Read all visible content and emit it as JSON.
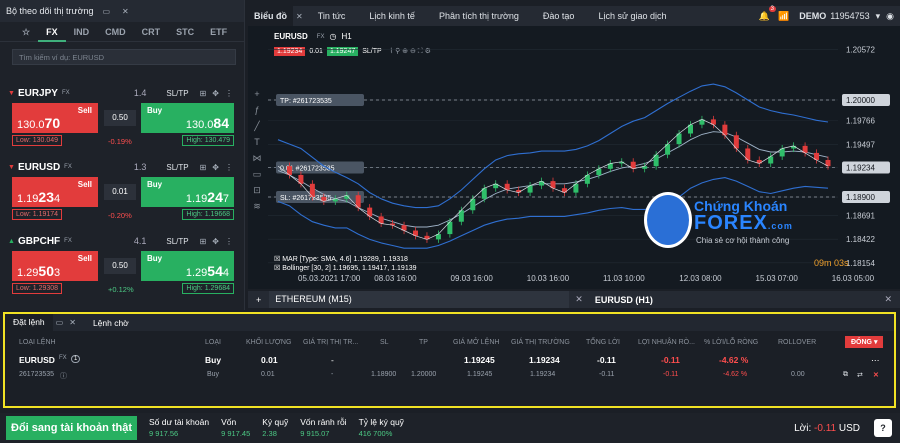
{
  "watchlist": {
    "title": "Bộ theo dõi thị trường",
    "tabs": [
      "FX",
      "IND",
      "CMD",
      "CRT",
      "STC",
      "ETF"
    ],
    "active_tab": "FX",
    "search_placeholder": "Tìm kiếm ví dụ: EURUSD",
    "instruments": [
      {
        "name": "EURJPY",
        "type": "FX",
        "spread": "1.4",
        "sell_label": "Sell",
        "buy_label": "Buy",
        "sell_price_main": "130.0",
        "sell_price_big": "70",
        "buy_price_main": "130.0",
        "buy_price_big": "84",
        "qty": "0.50",
        "low": "Low: 130.049",
        "high": "High: 130.479",
        "change": "-0.19%",
        "change_color": "#ff4e4e"
      },
      {
        "name": "EURUSD",
        "type": "FX",
        "spread": "1.3",
        "sell_label": "Sell",
        "buy_label": "Buy",
        "sell_price_main": "1.19",
        "sell_price_big": "23",
        "sell_price_tail": "4",
        "buy_price_main": "1.19",
        "buy_price_big": "24",
        "buy_price_tail": "7",
        "qty": "0.01",
        "low": "Low: 1.19174",
        "high": "High: 1.19668",
        "change": "-0.20%",
        "change_color": "#ff4e4e"
      },
      {
        "name": "GBPCHF",
        "type": "FX",
        "spread": "4.1",
        "sell_label": "Sell",
        "buy_label": "Buy",
        "sell_price_main": "1.29",
        "sell_price_big": "50",
        "sell_price_tail": "3",
        "buy_price_main": "1.29",
        "buy_price_big": "54",
        "buy_price_tail": "4",
        "qty": "0.50",
        "low": "Low: 1.29308",
        "high": "High: 1.29684",
        "change": "+0.12%",
        "change_color": "#4cc984"
      }
    ],
    "sltp_label": "SL/TP"
  },
  "chart_header": {
    "active": "Biểu đồ",
    "tabs": [
      "Tin tức",
      "Lịch kinh tế",
      "Phân tích thị trường",
      "Đào tạo",
      "Lịch sử giao dịch"
    ],
    "badge": "3",
    "account": "DEMO",
    "account_id": "11954753"
  },
  "chart_toolbar": {
    "symbol": "EURUSD",
    "type": "FX",
    "timeframe": "H1",
    "sell": "1.19234",
    "qty": "0.01",
    "buy": "1.19247",
    "sltp": "SL/TP"
  },
  "chart_data": {
    "type": "line",
    "y_ticks": [
      "1.20572",
      "1.20000",
      "1.19766",
      "1.19497",
      "1.19234",
      "1.18900",
      "1.18691",
      "1.18422",
      "1.18154"
    ],
    "x_ticks": [
      "05.03.2021 17:00",
      "08.03 16:00",
      "09.03 16:00",
      "10.03 16:00",
      "11.03 10:00",
      "12.03 08:00",
      "15.03 07:00",
      "16.03 05:00"
    ],
    "ylim": [
      1.1805,
      1.2068
    ],
    "price_line": [
      1.1925,
      1.1915,
      1.1905,
      1.189,
      1.1885,
      1.1888,
      1.1892,
      1.1878,
      1.1868,
      1.186,
      1.1858,
      1.1852,
      1.1846,
      1.1842,
      1.1848,
      1.1862,
      1.1875,
      1.1888,
      1.19,
      1.1905,
      1.1898,
      1.1895,
      1.1903,
      1.1908,
      1.19,
      1.1895,
      1.1905,
      1.1915,
      1.1922,
      1.1928,
      1.193,
      1.1922,
      1.1925,
      1.1938,
      1.195,
      1.1962,
      1.1972,
      1.1978,
      1.1972,
      1.196,
      1.1945,
      1.1932,
      1.1928,
      1.1936,
      1.1945,
      1.1948,
      1.194,
      1.1932,
      1.1925
    ],
    "ma_line": [
      1.192,
      1.1915,
      1.1908,
      1.19,
      1.1893,
      1.1888,
      1.1885,
      1.1878,
      1.1872,
      1.1866,
      1.1862,
      1.1858,
      1.1856,
      1.1856,
      1.1858,
      1.1864,
      1.1871,
      1.1879,
      1.1887,
      1.1894,
      1.1899,
      1.1901,
      1.1903,
      1.1905,
      1.1905,
      1.1905,
      1.1907,
      1.191,
      1.1914,
      1.1919,
      1.1923,
      1.1925,
      1.1928,
      1.1933,
      1.194,
      1.1947,
      1.1955,
      1.1961,
      1.1964,
      1.1963,
      1.1958,
      1.1951,
      1.1944,
      1.1941,
      1.1941,
      1.1942,
      1.1941,
      1.1938,
      1.1935
    ],
    "upper_band": [
      1.1955,
      1.195,
      1.1945,
      1.1935,
      1.1925,
      1.1918,
      1.1912,
      1.1905,
      1.1895,
      1.1888,
      1.1883,
      1.188,
      1.1878,
      1.1878,
      1.188,
      1.1888,
      1.1898,
      1.191,
      1.1922,
      1.1932,
      1.1937,
      1.1939,
      1.194,
      1.1942,
      1.1942,
      1.1942,
      1.1944,
      1.1948,
      1.1954,
      1.1962,
      1.197,
      1.1976,
      1.198,
      1.1988,
      1.1996,
      1.2003,
      1.201,
      1.2016,
      1.2018,
      1.2015,
      1.2008,
      1.2,
      1.1992,
      1.1988,
      1.1985,
      1.1983,
      1.198,
      1.1977,
      1.1975
    ],
    "lower_band": [
      1.1885,
      1.188,
      1.187,
      1.1862,
      1.1858,
      1.1855,
      1.1855,
      1.1848,
      1.1842,
      1.1838,
      1.1835,
      1.1832,
      1.1832,
      1.1832,
      1.1835,
      1.184,
      1.1846,
      1.1852,
      1.1858,
      1.1862,
      1.1865,
      1.1866,
      1.1868,
      1.1868,
      1.1868,
      1.1868,
      1.187,
      1.1872,
      1.1875,
      1.1877,
      1.1878,
      1.1876,
      1.1876,
      1.1878,
      1.1884,
      1.189,
      1.19,
      1.1906,
      1.191,
      1.1912,
      1.1908,
      1.1902,
      1.1896,
      1.1894,
      1.1897,
      1.19,
      1.1902,
      1.1901,
      1.19
    ],
    "tp_label": "TP: #261723535",
    "sl_label": "SL: #261723535",
    "entry_label": "0.01 #261723535",
    "tp_price": "1.20000",
    "current_price": "1.19234",
    "sl_price": "1.18900",
    "ma_legend": "☒ MAR [Type: SMA, 4.6] 1.19289, 1.19318",
    "bb_legend": "☒ Bollinger [30, 2] 1.19695, 1.19417, 1.19139",
    "timer": "09m 03s"
  },
  "watermark": {
    "line1": "Chứng Khoán",
    "line2": "FOREX",
    "suffix": ".com",
    "tagline": "Chia sẻ cơ hội thành công"
  },
  "chart_footer": {
    "tab1": "ETHEREUM (M15)",
    "tab2": "EURUSD (H1)"
  },
  "orders": {
    "tab_open": "Đặt lệnh",
    "tab_pending": "Lệnh chờ",
    "columns": [
      "LOẠI LỆNH",
      "LOẠI",
      "KHỐI LƯỢNG",
      "GIÁ TRỊ THỊ TR...",
      "SL",
      "TP",
      "GIÁ MỞ LỆNH",
      "GIÁ THỊ TRƯỜNG",
      "TỔNG LỜI",
      "LỢI NHUẬN RÒ...",
      "% LỜI/LỖ RÒNG",
      "ROLLOVER"
    ],
    "close_button": "ĐÓNG",
    "row_main": {
      "symbol": "EURUSD",
      "type": "FX",
      "count": "1",
      "side": "Buy",
      "volume": "0.01",
      "market_value": "-",
      "open_price": "1.19245",
      "market_price": "1.19234",
      "gross": "-0.11",
      "net": "-0.11",
      "pct": "-4.62 %"
    },
    "row_sub": {
      "id": "261723535",
      "side": "Buy",
      "volume": "0.01",
      "market_value": "-",
      "sl": "1.18900",
      "tp": "1.20000",
      "open_price": "1.19245",
      "market_price": "1.19234",
      "gross": "-0.11",
      "net": "-0.11",
      "pct": "-4.62 %",
      "rollover": "0.00"
    }
  },
  "status": {
    "real_account_button": "Đổi sang tài khoản thật",
    "stats": [
      {
        "label": "Số dư tài khoản",
        "value": "9 917.56"
      },
      {
        "label": "Vốn",
        "value": "9 917.45"
      },
      {
        "label": "Ký quỹ",
        "value": "2.38"
      },
      {
        "label": "Vốn rảnh rỗi",
        "value": "9 915.07"
      },
      {
        "label": "Tỷ lệ ký quỹ",
        "value": "416 700%"
      }
    ],
    "profit_label": "Lời:",
    "profit_value": "-0.11",
    "currency": "USD"
  }
}
